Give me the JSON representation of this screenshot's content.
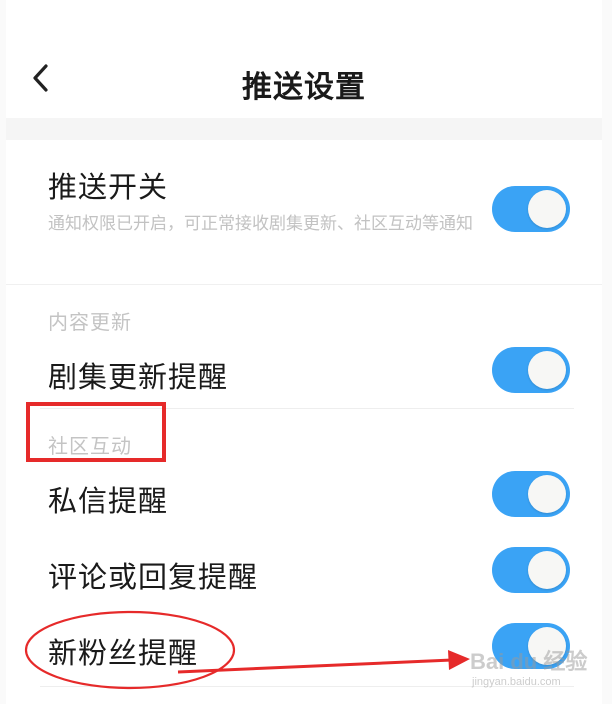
{
  "header": {
    "title": "推送设置",
    "back_icon": "chevron-left-icon"
  },
  "push_switch": {
    "label": "推送开关",
    "description": "通知权限已开启，可正常接收剧集更新、社区互动等通知",
    "enabled": true
  },
  "sections": [
    {
      "title": "内容更新",
      "items": [
        {
          "label": "剧集更新提醒",
          "enabled": true
        }
      ]
    },
    {
      "title": "社区互动",
      "items": [
        {
          "label": "私信提醒",
          "enabled": true
        },
        {
          "label": "评论或回复提醒",
          "enabled": true
        },
        {
          "label": "新粉丝提醒",
          "enabled": true
        }
      ]
    }
  ],
  "colors": {
    "toggle_on": "#3aa3f5",
    "annotation": "#e62a2a"
  },
  "watermark": {
    "brand": "Bai du 经验",
    "url": "jingyan.baidu.com"
  }
}
